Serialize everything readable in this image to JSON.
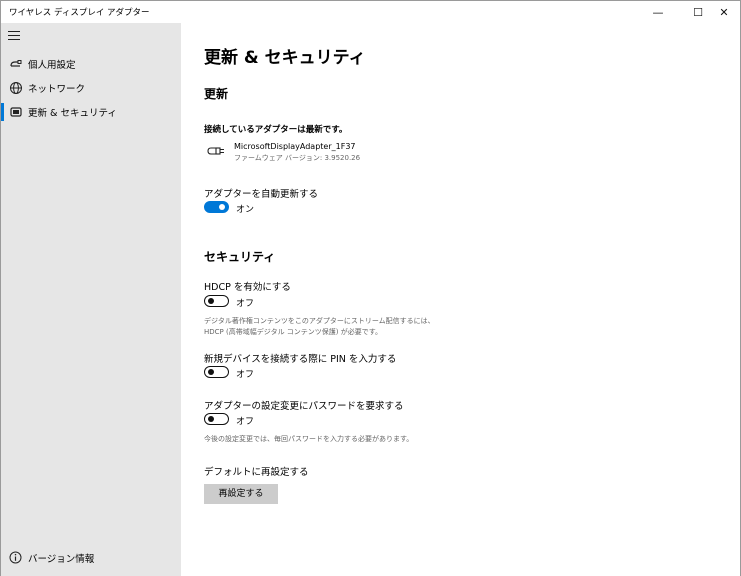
{
  "window": {
    "title": "ワイヤレス ディスプレイ アダプター"
  },
  "titlebar_controls": {
    "minimize": "—",
    "maximize": "☐",
    "close": "✕"
  },
  "sidebar": {
    "items": [
      {
        "label": "個人用設定",
        "icon": "personalize-icon",
        "active": false
      },
      {
        "label": "ネットワーク",
        "icon": "globe-icon",
        "active": false
      },
      {
        "label": "更新 & セキュリティ",
        "icon": "adapter-icon",
        "active": true
      }
    ],
    "version_label": "バージョン情報"
  },
  "main": {
    "page_title": "更新 & セキュリティ",
    "update": {
      "heading": "更新",
      "status": "接続しているアダプターは最新です。",
      "device_name": "MicrosoftDisplayAdapter_1F37",
      "firmware": "ファームウェア バージョン: 3.9520.26",
      "auto_update_label": "アダプターを自動更新する",
      "auto_update_state": "オン"
    },
    "security": {
      "heading": "セキュリティ",
      "hdcp_label": "HDCP を有効にする",
      "hdcp_state": "オフ",
      "hdcp_desc": "デジタル著作権コンテンツをこのアダプターにストリーム配信するには、HDCP (高帯域幅デジタル コンテンツ保護) が必要です。",
      "pin_label": "新規デバイスを接続する際に PIN を入力する",
      "pin_state": "オフ",
      "password_label": "アダプターの設定変更にパスワードを要求する",
      "password_state": "オフ",
      "password_desc": "今後の設定変更では、毎回パスワードを入力する必要があります。"
    },
    "reset": {
      "label": "デフォルトに再設定する",
      "button": "再設定する"
    }
  },
  "colors": {
    "accent": "#0078d7",
    "sidebar_bg": "#e6e6e6",
    "button_bg": "#cccccc"
  }
}
